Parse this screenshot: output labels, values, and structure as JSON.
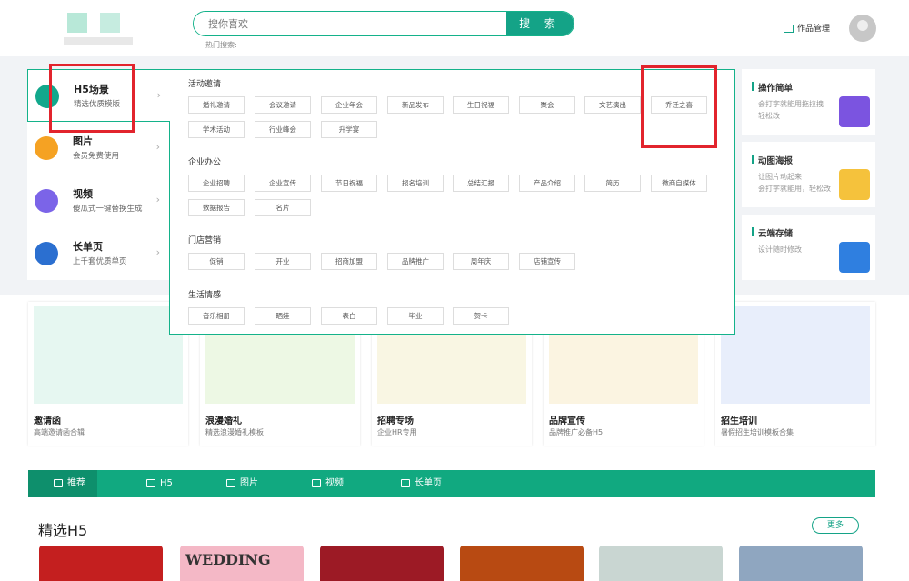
{
  "header": {
    "search_placeholder": "搜你喜欢",
    "search_button": "搜 索",
    "hot_label": "热门搜索:",
    "works_label": "作品管理"
  },
  "nav": [
    {
      "title": "H5场景",
      "subtitle": "精选优质模版",
      "icon": "h5-icon",
      "color": "#12a88c"
    },
    {
      "title": "图片",
      "subtitle": "会员免费使用",
      "icon": "image-icon",
      "color": "#f5a223"
    },
    {
      "title": "视频",
      "subtitle": "傻瓜式一键替换生成",
      "icon": "video-icon",
      "color": "#7b64e8"
    },
    {
      "title": "长单页",
      "subtitle": "上千套优质单页",
      "icon": "layers-icon",
      "color": "#2b6fd0"
    }
  ],
  "mega": {
    "categories": [
      {
        "title": "活动邀请",
        "tags": [
          "婚礼邀请",
          "会议邀请",
          "企业年会",
          "新品发布",
          "生日祝福",
          "聚会",
          "文艺演出",
          "乔迁之喜",
          "学术活动",
          "行业峰会",
          "升学宴"
        ]
      },
      {
        "title": "企业办公",
        "tags": [
          "企业招聘",
          "企业宣传",
          "节日祝福",
          "报名培训",
          "总结汇报",
          "产品介绍",
          "简历",
          "微商自媒体",
          "数据报告",
          "名片"
        ]
      },
      {
        "title": "门店营销",
        "tags": [
          "促销",
          "开业",
          "招商加盟",
          "品牌推广",
          "周年庆",
          "店铺宣传"
        ]
      },
      {
        "title": "生活情感",
        "tags": [
          "音乐相册",
          "晒娃",
          "表白",
          "毕业",
          "贺卡"
        ]
      }
    ]
  },
  "right_cards": [
    {
      "title": "操作简单",
      "desc": "会打字就能用拖拉拽\n轻松改",
      "color": "#7b54e0"
    },
    {
      "title": "动图海报",
      "desc": "让图片动起来\n会打字就能用，轻松改",
      "color": "#f5c23c"
    },
    {
      "title": "云端存储",
      "desc": "设计随时修改",
      "color": "#2f7fe0"
    }
  ],
  "templates": [
    {
      "name": "邀请函",
      "desc": "高端邀请函合辑",
      "bg": "#e6f7f1"
    },
    {
      "name": "浪漫婚礼",
      "desc": "精选浪漫婚礼模板",
      "bg": "#edf8e4"
    },
    {
      "name": "招聘专场",
      "desc": "企业HR专用",
      "bg": "#f9f6e3"
    },
    {
      "name": "品牌宣传",
      "desc": "品牌推广必备H5",
      "bg": "#fbf4e1"
    },
    {
      "name": "招生培训",
      "desc": "暑假招生培训模板合集",
      "bg": "#e8eefb"
    }
  ],
  "tabs": [
    "推荐",
    "H5",
    "图片",
    "视频",
    "长单页"
  ],
  "section_title": "精选H5",
  "more_label": "更多",
  "h5_cards": [
    {
      "caption": "",
      "bg": "#c41f1f"
    },
    {
      "caption": "WEDDING",
      "bg": "#f4b8c6"
    },
    {
      "caption": "",
      "bg": "#9c1a25"
    },
    {
      "caption": "",
      "bg": "#b84a12"
    },
    {
      "caption": "",
      "bg": "#c9d6d2"
    },
    {
      "caption": "",
      "bg": "#8fa6c0"
    }
  ]
}
